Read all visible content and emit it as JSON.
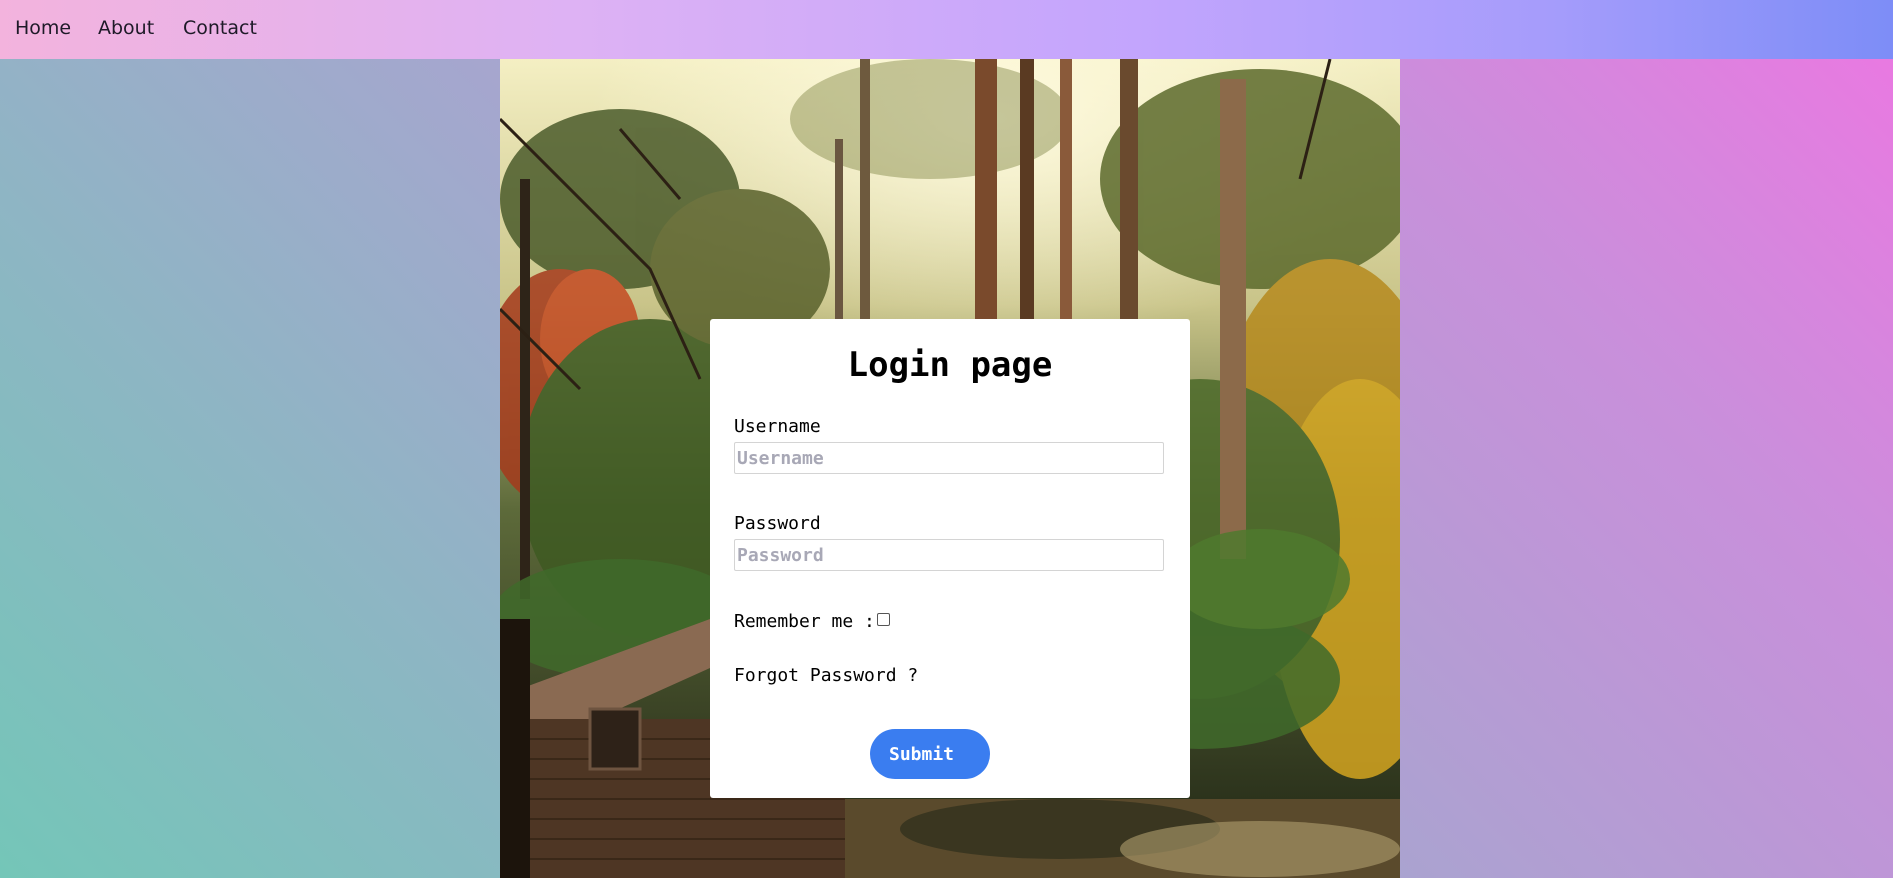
{
  "nav": {
    "home": "Home",
    "about": "About",
    "contact": "Contact"
  },
  "background_image": {
    "icon": "forest-cabin-photo"
  },
  "login": {
    "title": "Login page",
    "username_label": "Username",
    "username_placeholder": "Username",
    "username_value": "",
    "password_label": "Password",
    "password_placeholder": "Password",
    "password_value": "",
    "remember_label": "Remember me :",
    "remember_checked": false,
    "forgot_label": "Forgot Password ?",
    "submit_label": "Submit"
  },
  "colors": {
    "submit_button": "#3a7df0",
    "nav_gradient_start": "#f3b3dd",
    "nav_gradient_end": "#7d8df7"
  }
}
